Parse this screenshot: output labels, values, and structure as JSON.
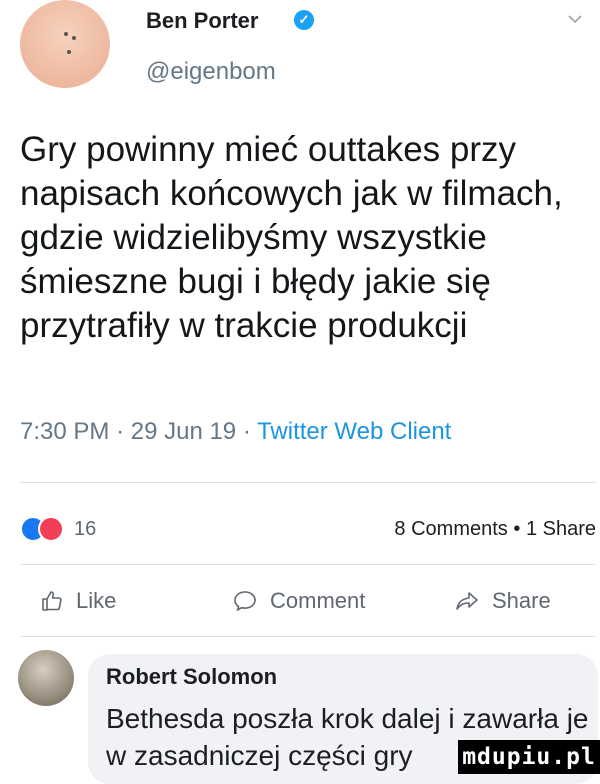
{
  "post": {
    "author_name": "Ben Porter",
    "author_handle": "@eigenbom",
    "verified_icon": "verified-badge-icon",
    "text": "Gry powinny mieć outtakes przy napisach końcowych jak w filmach, gdzie widzielibyśmy wszystkie śmieszne bugi i błędy jakie się przytrafiły w trakcie produkcji",
    "time": "7:30 PM",
    "date": "29 Jun 19",
    "client": "Twitter Web Client",
    "separator": "·"
  },
  "stats": {
    "reaction_count": "16",
    "comments": "8 Comments",
    "bullet": "•",
    "shares": "1 Share"
  },
  "actions": {
    "like": "Like",
    "comment": "Comment",
    "share": "Share"
  },
  "comment": {
    "author": "Robert Solomon",
    "text": "Bethesda poszła krok dalej i zawarła je w zasadniczej części gry"
  },
  "watermark": "mdupiu.pl",
  "colors": {
    "link": "#1b95e0",
    "reaction_like": "#1877f2",
    "reaction_love": "#f33e58",
    "verified": "#1da1f2"
  }
}
